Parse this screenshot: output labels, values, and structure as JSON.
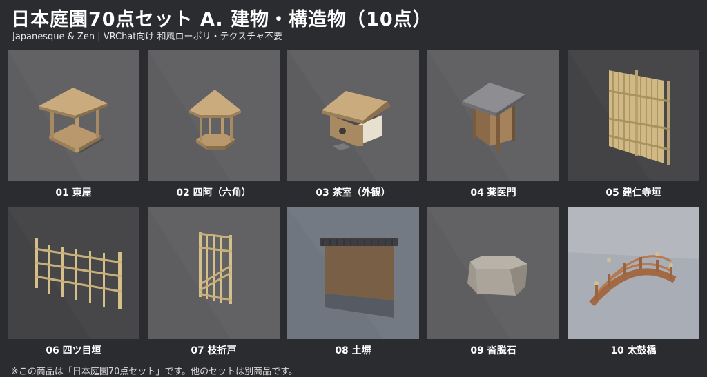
{
  "header": {
    "title": "日本庭園70点セット A. 建物・構造物（10点）",
    "subtitle": "Japanesque & Zen | VRChat向け 和風ローポリ・テクスチャ不要"
  },
  "items": [
    {
      "label": "01 東屋"
    },
    {
      "label": "02 四阿（六角）"
    },
    {
      "label": "03 茶室（外観）"
    },
    {
      "label": "04 薬医門"
    },
    {
      "label": "05 建仁寺垣"
    },
    {
      "label": "06 四ツ目垣"
    },
    {
      "label": "07 枝折戸"
    },
    {
      "label": "08 土塀"
    },
    {
      "label": "09 沓脱石"
    },
    {
      "label": "10 太鼓橋"
    }
  ],
  "footer": {
    "note": "※この商品は「日本庭園70点セット」です。他のセットは別商品です。"
  },
  "colors": {
    "background": "#2b2c30",
    "thumb_gray": "#5d5d5f",
    "thumb_dark": "#434345",
    "thumb_blue": "#6f7680",
    "thumb_light": "#a9adb5",
    "wood": "#c9a97a",
    "bamboo": "#d6c08a"
  }
}
